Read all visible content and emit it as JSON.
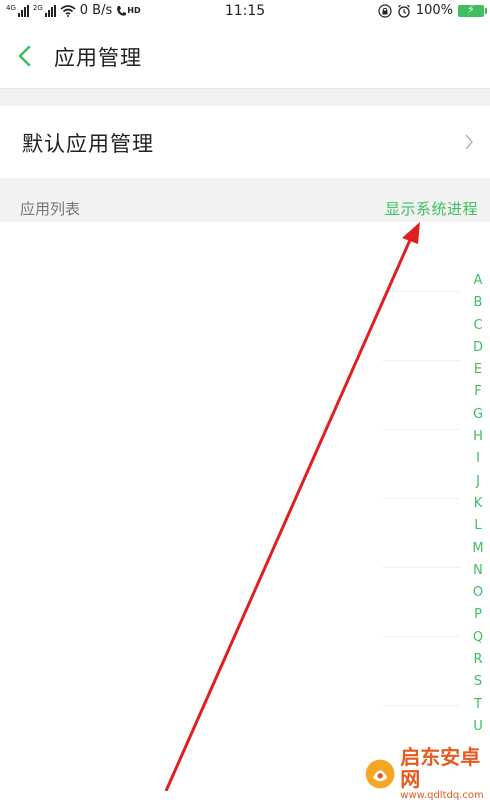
{
  "status_bar": {
    "net1": "4G",
    "net2": "2G",
    "speed": "0 B/s",
    "hd": "HD",
    "time": "11:15",
    "battery": "100%"
  },
  "header": {
    "title": "应用管理"
  },
  "default_apps": {
    "label": "默认应用管理"
  },
  "app_list": {
    "label": "应用列表",
    "show_system_label": "显示系统进程"
  },
  "alpha_index": [
    "A",
    "B",
    "C",
    "D",
    "E",
    "F",
    "G",
    "H",
    "I",
    "J",
    "K",
    "L",
    "M",
    "N",
    "O",
    "P",
    "Q",
    "R",
    "S",
    "T",
    "U"
  ],
  "watermark": {
    "title": "启东安卓网",
    "url": "www.qdltdq.com"
  },
  "colors": {
    "accent": "#3fbf62",
    "arrow": "#e02020",
    "watermark": "#e65a1e"
  }
}
